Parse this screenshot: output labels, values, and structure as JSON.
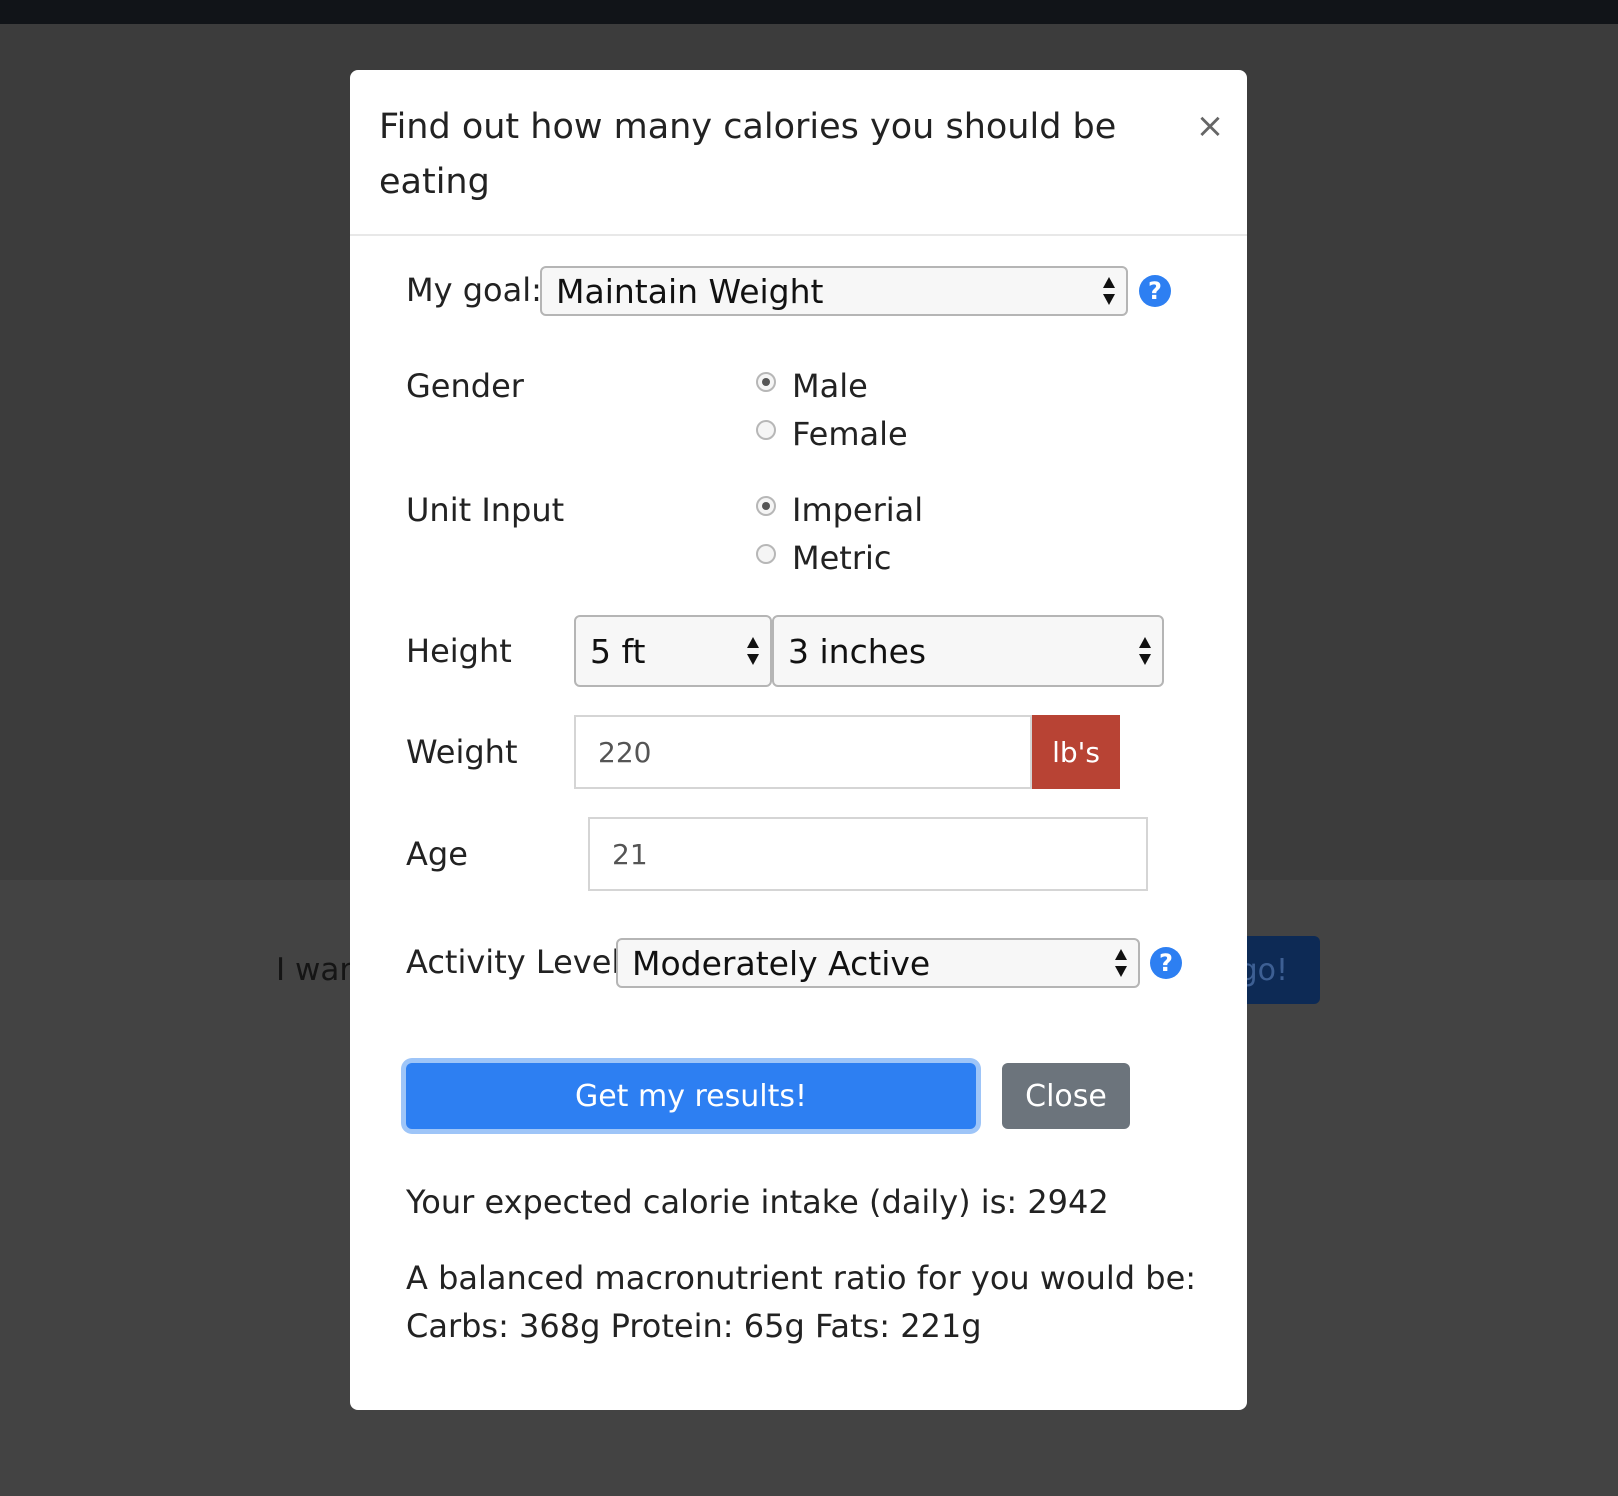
{
  "background": {
    "partial_text": "I war",
    "go_button_label": "go!"
  },
  "modal": {
    "title": "Find out how many calories you should be eating",
    "close_icon": "×"
  },
  "goal": {
    "label": "My goal:",
    "selected": "Maintain Weight",
    "help_icon": "?"
  },
  "gender": {
    "label": "Gender",
    "options": [
      "Male",
      "Female"
    ],
    "selected": "Male"
  },
  "unit_input": {
    "label": "Unit Input",
    "options": [
      "Imperial",
      "Metric"
    ],
    "selected": "Imperial"
  },
  "height": {
    "label": "Height",
    "feet_selected": "5 ft",
    "inches_selected": "3 inches"
  },
  "weight": {
    "label": "Weight",
    "value": "220",
    "unit": "lb's"
  },
  "age": {
    "label": "Age",
    "value": "21"
  },
  "activity": {
    "label": "Activity Level:",
    "selected": "Moderately Active",
    "help_icon": "?"
  },
  "buttons": {
    "submit_label": "Get my results!",
    "close_label": "Close"
  },
  "results": {
    "calorie_line": "Your expected calorie intake (daily) is: 2942",
    "macro_line_1": "A balanced macronutrient ratio for you would be:",
    "macro_line_2": "Carbs: 368g Protein: 65g Fats: 221g"
  },
  "colors": {
    "primary": "#2d7ff2",
    "secondary": "#6c747c",
    "addon": "#b84334",
    "overlay": "#404040"
  }
}
